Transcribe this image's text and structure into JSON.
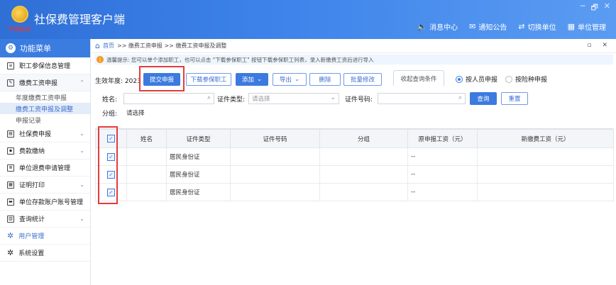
{
  "app": {
    "title": "社保费管理客户端",
    "logo_text": "中国税务"
  },
  "window_controls": [
    "─",
    "🗗",
    "✕"
  ],
  "topnav": [
    {
      "icon": "speaker-icon",
      "glyph": "🔈",
      "label": "消息中心"
    },
    {
      "icon": "mail-icon",
      "glyph": "✉",
      "label": "通知公告"
    },
    {
      "icon": "switch-icon",
      "glyph": "⇄",
      "label": "切换单位"
    },
    {
      "icon": "building-icon",
      "glyph": "▦",
      "label": "单位管理"
    }
  ],
  "sidebar": {
    "header": "功能菜单",
    "items": [
      {
        "label": "职工参保信息管理",
        "chevron": ""
      },
      {
        "label": "缴费工资申报",
        "chevron": "⌃"
      },
      {
        "label": "社保费申报",
        "chevron": "⌄"
      },
      {
        "label": "费款缴纳",
        "chevron": "⌄"
      },
      {
        "label": "单位退费申请管理",
        "chevron": ""
      },
      {
        "label": "证明打印",
        "chevron": "⌄"
      },
      {
        "label": "单位存款账户账号管理",
        "chevron": ""
      },
      {
        "label": "查询统计",
        "chevron": "⌄"
      },
      {
        "label": "用户管理",
        "chevron": ""
      },
      {
        "label": "系统设置",
        "chevron": ""
      }
    ],
    "subitems": [
      "年度缴费工资申报",
      "缴费工资申报及调整",
      "申报记录"
    ]
  },
  "breadcrumb": {
    "home": "首页",
    "path": ">> 缴费工资申报 >> 缴费工资申报及调整",
    "controls": "▫ ✕"
  },
  "tip": {
    "text": "温馨提示: 您可以单个添加职工，也可以点击 \"下载参保职工\" 按钮下载参保职工列表，录入新缴费工资后进行导入"
  },
  "toolbar": {
    "year_label": "生效年度: 2023",
    "submit": "提交申报",
    "download": "下载参保职工",
    "add": "添加",
    "export": "导出",
    "delete": "删除",
    "batch_edit": "批量修改",
    "collapse": "收起查询条件",
    "radio_person": "按人员申报",
    "radio_type": "按险种申报"
  },
  "filters": {
    "name_label": "姓名:",
    "id_type_label": "证件类型:",
    "id_type_placeholder": "请选择",
    "id_no_label": "证件号码:",
    "group_label": "分组:",
    "group_value": "请选择",
    "query": "查询",
    "reset": "重置"
  },
  "table": {
    "columns": [
      "",
      "姓名",
      "证件类型",
      "证件号码",
      "分组",
      "原申报工资（元）",
      "新缴费工资（元）"
    ],
    "rows": [
      {
        "checked": true,
        "name": "",
        "id_type": "居民身份证",
        "id_no": "",
        "group": "",
        "old_wage": "--",
        "new_wage": ""
      },
      {
        "checked": true,
        "name": "",
        "id_type": "居民身份证",
        "id_no": "",
        "group": "",
        "old_wage": "--",
        "new_wage": ""
      },
      {
        "checked": true,
        "name": "",
        "id_type": "居民身份证",
        "id_no": "",
        "group": "",
        "old_wage": "--",
        "new_wage": ""
      }
    ]
  },
  "colors": {
    "header_blue": "#3d83ea",
    "primary_button": "#3c7ae0",
    "highlight_red": "#e53b3b"
  }
}
